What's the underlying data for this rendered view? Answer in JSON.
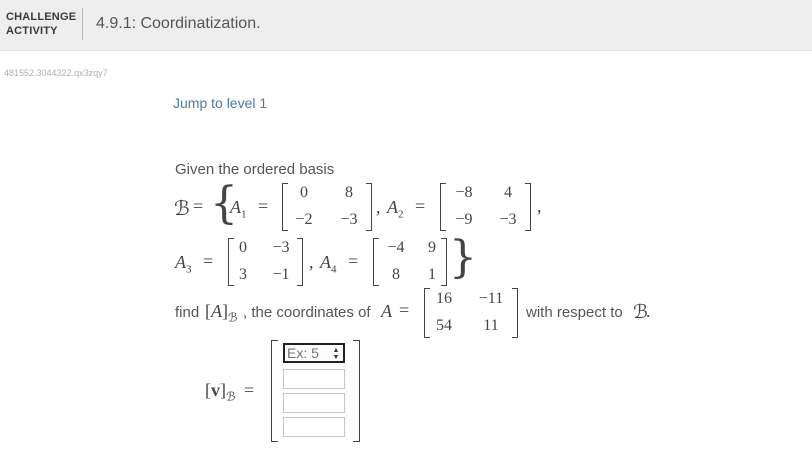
{
  "header": {
    "label_line1": "CHALLENGE",
    "label_line2": "ACTIVITY",
    "title": "4.9.1: Coordinatization."
  },
  "activity_id": "481552.3044322.qx3zqy7",
  "jump_link": "Jump to level 1",
  "problem": {
    "intro": "Given the ordered basis",
    "basis_symbol": "ℬ",
    "equals": "=",
    "A1_label": "A",
    "A1_sub": "1",
    "A2_label": "A",
    "A2_sub": "2",
    "A3_label": "A",
    "A3_sub": "3",
    "A4_label": "A",
    "A4_sub": "4",
    "A1": [
      [
        "0",
        "8"
      ],
      [
        "−2",
        "−3"
      ]
    ],
    "A2": [
      [
        "−8",
        "4"
      ],
      [
        "−9",
        "−3"
      ]
    ],
    "A3": [
      [
        "0",
        "−3"
      ],
      [
        "3",
        "−1"
      ]
    ],
    "A4": [
      [
        "−4",
        "9"
      ],
      [
        "8",
        "1"
      ]
    ],
    "find_text": "find",
    "coords_text": ", the coordinates of",
    "A_symbol": "A",
    "A": [
      [
        "16",
        "−11"
      ],
      [
        "54",
        "11"
      ]
    ],
    "respect_text": "with respect to",
    "period": ".",
    "answer_label_v": "v",
    "answer_label_sub": "ℬ"
  },
  "answer_inputs": [
    {
      "placeholder": "Ex: 5",
      "value": ""
    },
    {
      "placeholder": "",
      "value": ""
    },
    {
      "placeholder": "",
      "value": ""
    },
    {
      "placeholder": "",
      "value": ""
    }
  ]
}
